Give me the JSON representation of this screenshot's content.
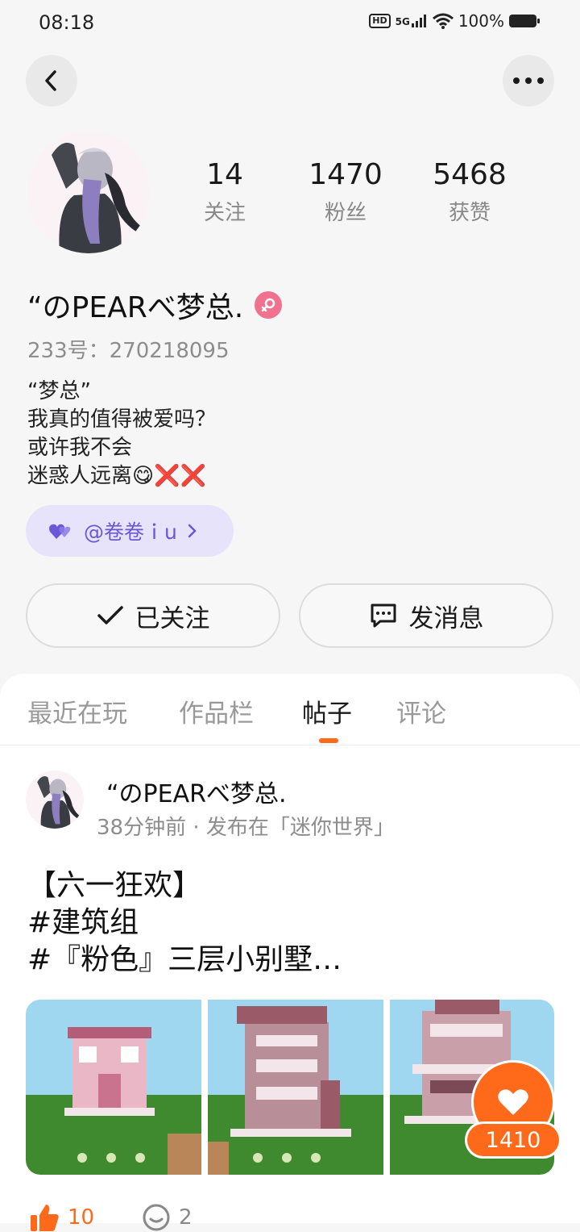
{
  "status_bar": {
    "time": "08:18",
    "network": "HD",
    "signal": "5G",
    "battery": "100%"
  },
  "profile": {
    "stats": [
      {
        "value": "14",
        "label": "关注"
      },
      {
        "value": "1470",
        "label": "粉丝"
      },
      {
        "value": "5468",
        "label": "获赞"
      }
    ],
    "username": "“のPEARべ梦总.",
    "gender": "female",
    "uid": "233号：270218095",
    "bio_lines": [
      "“梦总”",
      "我真的值得被爱吗？",
      "或许我不会",
      "迷惑人远离😋❌❌"
    ],
    "mention": "@卷卷ｉu",
    "follow_button": "已关注",
    "message_button": "发消息"
  },
  "tabs": [
    {
      "label": "最近在玩",
      "active": false
    },
    {
      "label": "作品栏",
      "active": false
    },
    {
      "label": "帖子",
      "active": true
    },
    {
      "label": "评论",
      "active": false
    }
  ],
  "post": {
    "author": "“のPEARべ梦总.",
    "meta": "38分钟前 · 发布在「迷你世界」",
    "body_lines": [
      "【六一狂欢】",
      "#建筑组",
      "#『粉色』三层小别墅…"
    ],
    "image_like_count": "1410",
    "like_count": "10",
    "comment_count": "2"
  },
  "colors": {
    "accent": "#ff6a1a",
    "mention_bg": "#e7e3fb",
    "mention_text": "#6a57d8",
    "gender": "#f1728f"
  }
}
